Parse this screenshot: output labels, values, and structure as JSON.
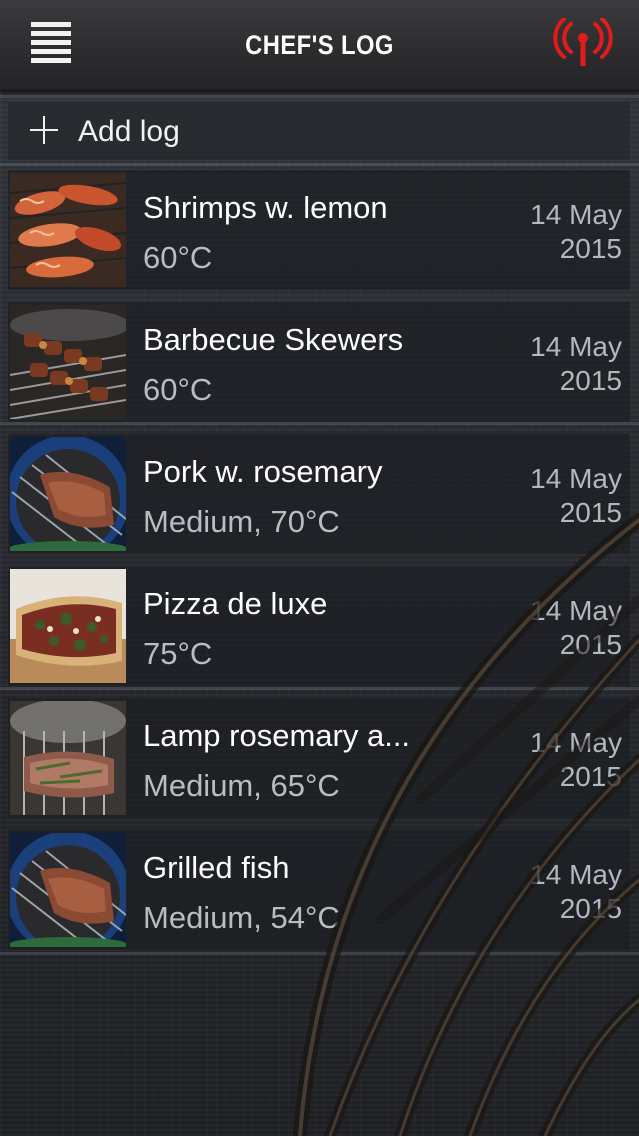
{
  "header": {
    "title": "CHEF'S LOG",
    "menu_icon": "hamburger-menu-icon",
    "signal_icon": "wireless-signal-icon",
    "signal_color": "#e31b1b"
  },
  "add_log": {
    "label": "Add log",
    "icon": "plus-icon"
  },
  "logs": [
    {
      "title": "Shrimps w. lemon",
      "subtitle": "60°C",
      "date_day": "14 May",
      "date_year": "2015",
      "thumbnail": "shrimps-photo"
    },
    {
      "title": "Barbecue Skewers",
      "subtitle": "60°C",
      "date_day": "14 May",
      "date_year": "2015",
      "thumbnail": "skewers-photo"
    },
    {
      "title": "Pork w. rosemary",
      "subtitle": "Medium, 70°C",
      "date_day": "14 May",
      "date_year": "2015",
      "thumbnail": "pork-photo"
    },
    {
      "title": "Pizza de luxe",
      "subtitle": "75°C",
      "date_day": "14 May",
      "date_year": "2015",
      "thumbnail": "pizza-photo"
    },
    {
      "title": "Lamp rosemary a...",
      "subtitle": "Medium, 65°C",
      "date_day": "14 May",
      "date_year": "2015",
      "thumbnail": "lamb-photo"
    },
    {
      "title": "Grilled fish",
      "subtitle": "Medium, 54°C",
      "date_day": "14 May",
      "date_year": "2015",
      "thumbnail": "fish-photo"
    }
  ]
}
